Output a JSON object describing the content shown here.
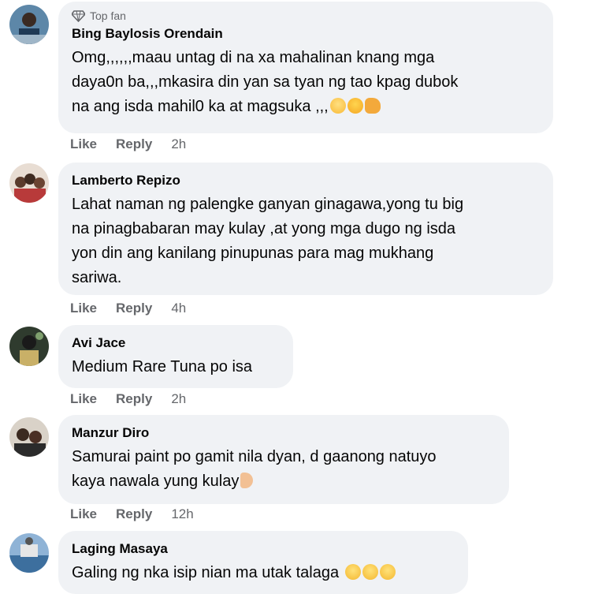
{
  "comments": [
    {
      "badge": "Top fan",
      "author": "Bing Baylosis Orendain",
      "text": "Omg,,,,,,maau untag di na xa mahalinan knang mga\ndaya0n ba,,,mkasira din yan sa tyan ng tao kpag dubok\nna ang isda mahil0 ka at magsuka ,,,",
      "like": "Like",
      "reply": "Reply",
      "time": "2h",
      "emojis": [
        "crying-face-emoji",
        "sad-face-emoji",
        "fist-emoji"
      ]
    },
    {
      "author": "Lamberto Repizo",
      "text": "Lahat naman ng palengke ganyan ginagawa,yong tu big\nna pinagbabaran may kulay ,at yong mga dugo ng isda\nyon din ang kanilang pinupunas para mag mukhang\nsariwa.",
      "like": "Like",
      "reply": "Reply",
      "time": "4h"
    },
    {
      "author": "Avi Jace",
      "text": "Medium Rare Tuna po isa",
      "like": "Like",
      "reply": "Reply",
      "time": "2h"
    },
    {
      "author": "Manzur Diro",
      "text": "Samurai paint po gamit nila dyan, d gaanong natuyo\nkaya nawala yung kulay",
      "like": "Like",
      "reply": "Reply",
      "time": "12h",
      "emojis": [
        "victory-hand-emoji"
      ]
    },
    {
      "author": "Laging Masaya",
      "text": "Galing ng nka isip nian ma utak talaga",
      "emojis": [
        "grinning-face-emoji",
        "grinning-face-emoji",
        "grinning-face-emoji"
      ]
    }
  ],
  "colors": {
    "bubble": "#f0f2f5",
    "secondary_text": "#65676b",
    "primary_text": "#050505"
  }
}
